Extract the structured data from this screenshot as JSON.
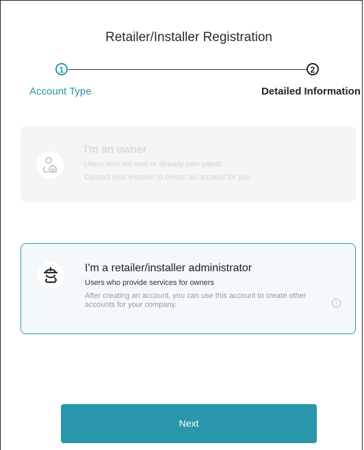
{
  "page": {
    "title": "Retailer/Installer Registration"
  },
  "stepper": {
    "steps": [
      {
        "number": "1",
        "label": "Account Type",
        "state": "active"
      },
      {
        "number": "2",
        "label": "Detailed Information",
        "state": "upcoming"
      }
    ]
  },
  "cards": {
    "owner": {
      "title": "I'm an owner",
      "description": "Users who will own or already own plants",
      "note": "Contact your installer to create an account for you",
      "state": "disabled",
      "icon": "owner-house-icon"
    },
    "retailer": {
      "title": "I'm a retailer/installer administrator",
      "description": "Users who provide services for owners",
      "note": "After creating an account, you can use this account to create other accounts for your company.",
      "state": "selected",
      "icon": "installer-helmet-icon",
      "info_icon": "info-icon"
    }
  },
  "actions": {
    "next_label": "Next"
  },
  "colors": {
    "accent": "#2a96ab",
    "selected_card_bg": "#f4f8fa",
    "disabled_card_bg": "#f5f5f5"
  }
}
